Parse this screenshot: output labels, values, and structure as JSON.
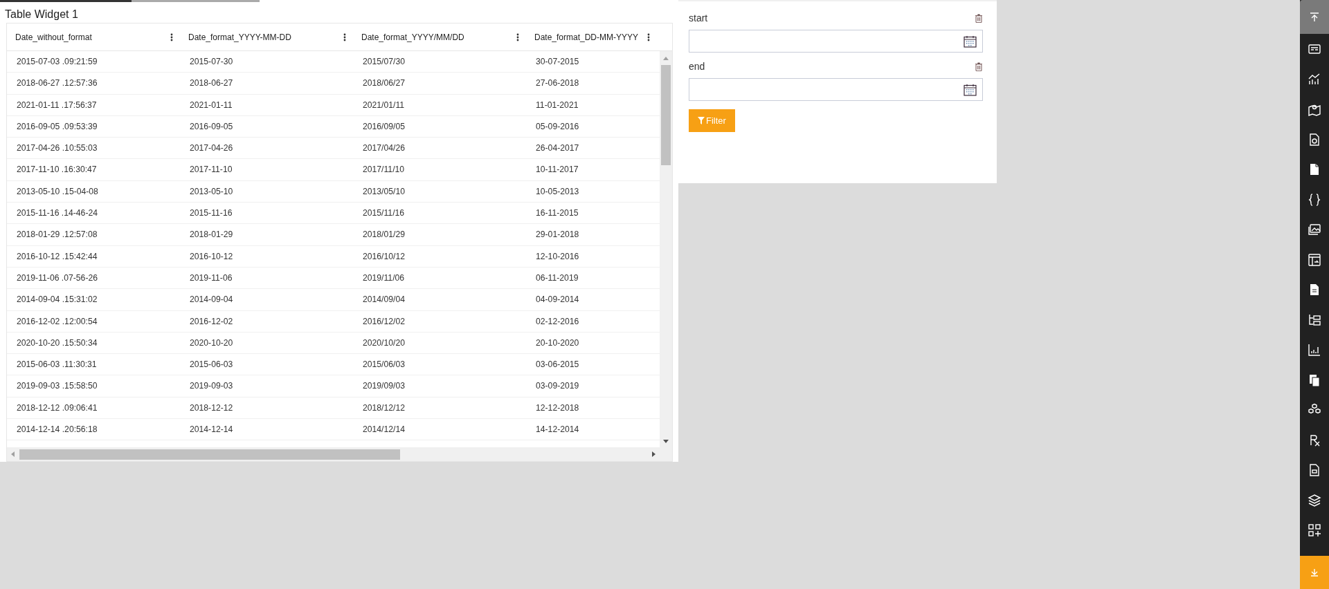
{
  "widget": {
    "title": "Table Widget 1"
  },
  "table": {
    "columns": [
      "Date_without_format",
      "Date_format_YYYY-MM-DD",
      "Date_format_YYYY/MM/DD",
      "Date_format_DD-MM-YYYY"
    ],
    "rows": [
      [
        "2015-07-03 .09:21:59",
        "2015-07-30",
        "2015/07/30",
        "30-07-2015"
      ],
      [
        "2018-06-27 .12:57:36",
        "2018-06-27",
        "2018/06/27",
        "27-06-2018"
      ],
      [
        "2021-01-11 .17:56:37",
        "2021-01-11",
        "2021/01/11",
        "11-01-2021"
      ],
      [
        "2016-09-05 .09:53:39",
        "2016-09-05",
        "2016/09/05",
        "05-09-2016"
      ],
      [
        "2017-04-26 .10:55:03",
        "2017-04-26",
        "2017/04/26",
        "26-04-2017"
      ],
      [
        "2017-11-10 .16:30:47",
        "2017-11-10",
        "2017/11/10",
        "10-11-2017"
      ],
      [
        "2013-05-10 .15-04-08",
        "2013-05-10",
        "2013/05/10",
        "10-05-2013"
      ],
      [
        "2015-11-16 .14-46-24",
        "2015-11-16",
        "2015/11/16",
        "16-11-2015"
      ],
      [
        "2018-01-29 .12:57:08",
        "2018-01-29",
        "2018/01/29",
        "29-01-2018"
      ],
      [
        "2016-10-12 .15:42:44",
        "2016-10-12",
        "2016/10/12",
        "12-10-2016"
      ],
      [
        "2019-11-06 .07-56-26",
        "2019-11-06",
        "2019/11/06",
        "06-11-2019"
      ],
      [
        "2014-09-04 .15:31:02",
        "2014-09-04",
        "2014/09/04",
        "04-09-2014"
      ],
      [
        "2016-12-02 .12:00:54",
        "2016-12-02",
        "2016/12/02",
        "02-12-2016"
      ],
      [
        "2020-10-20 .15:50:34",
        "2020-10-20",
        "2020/10/20",
        "20-10-2020"
      ],
      [
        "2015-06-03 .11:30:31",
        "2015-06-03",
        "2015/06/03",
        "03-06-2015"
      ],
      [
        "2019-09-03 .15:58:50",
        "2019-09-03",
        "2019/09/03",
        "03-09-2019"
      ],
      [
        "2018-12-12 .09:06:41",
        "2018-12-12",
        "2018/12/12",
        "12-12-2018"
      ],
      [
        "2014-12-14 .20:56:18",
        "2014-12-14",
        "2014/12/14",
        "14-12-2014"
      ]
    ]
  },
  "filter": {
    "fields": [
      {
        "label": "start"
      },
      {
        "label": "end"
      }
    ],
    "button": "Filter"
  }
}
